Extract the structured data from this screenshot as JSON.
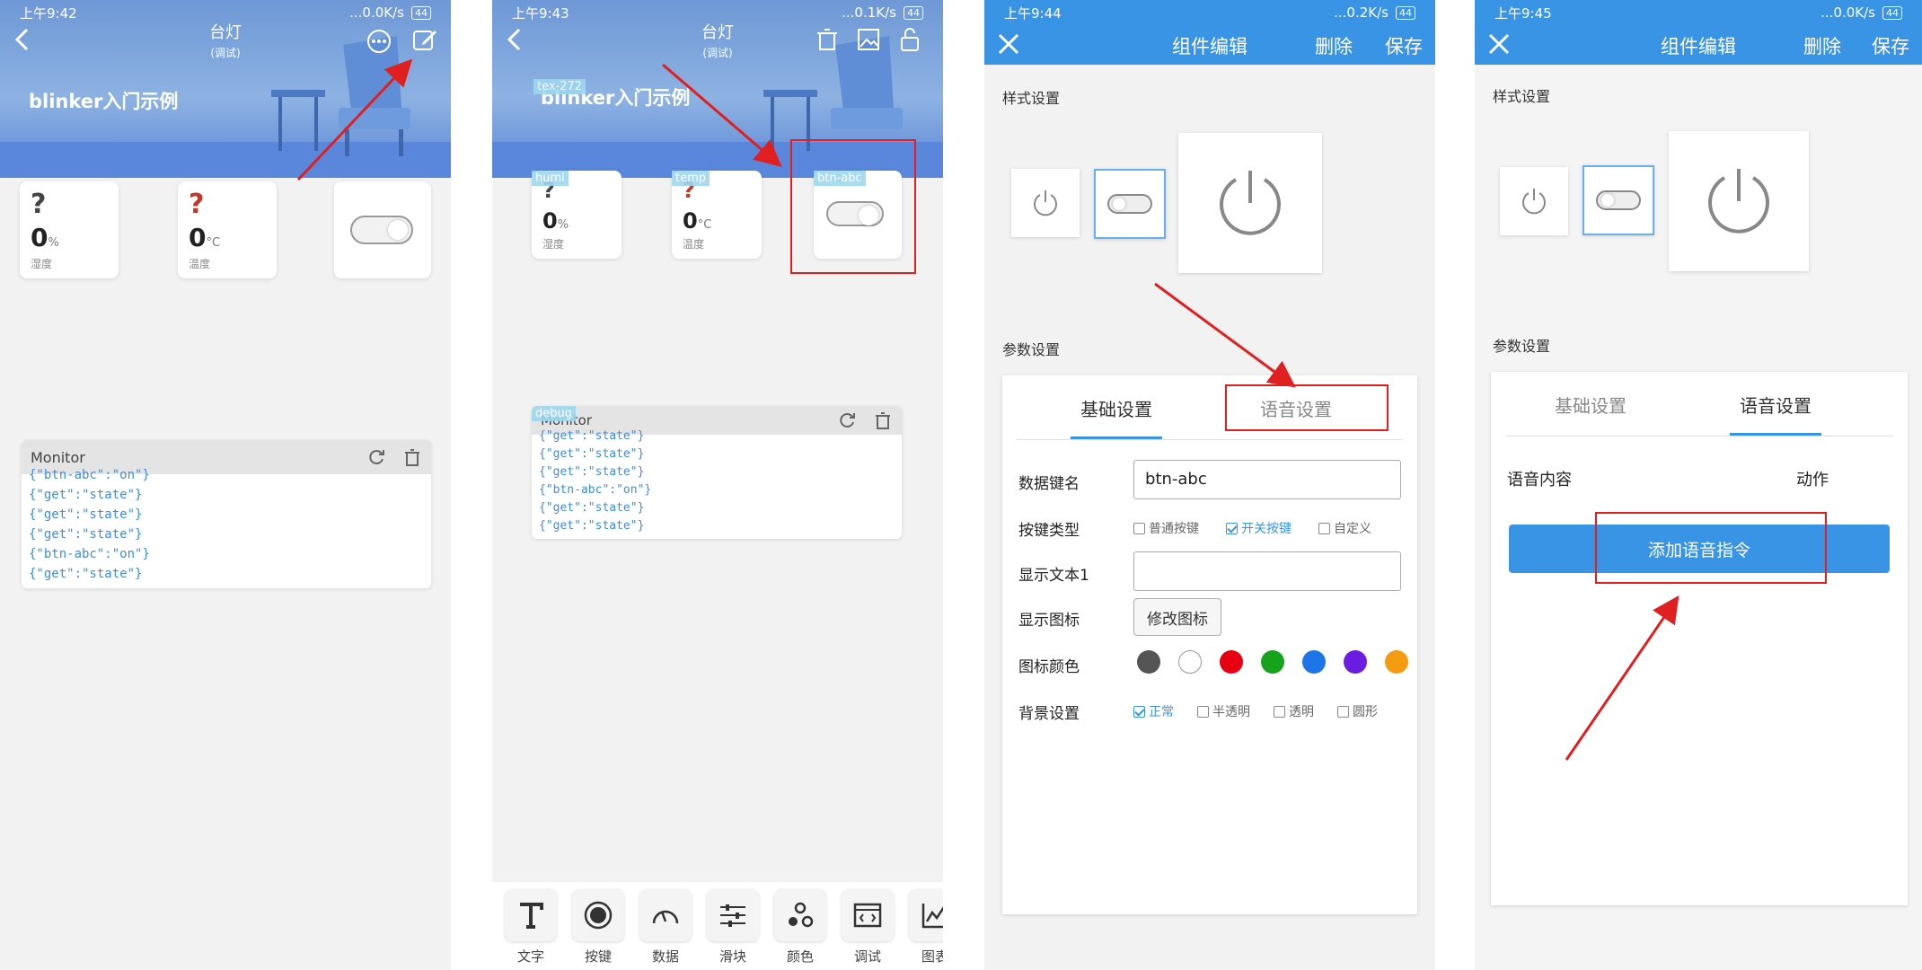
{
  "panel1": {
    "status": {
      "time": "上午9:42",
      "net": "...0.0K/s",
      "battery": "44"
    },
    "title": "台灯",
    "subtitle": "(调试)",
    "device_name": "blinker入门示例",
    "cards": [
      {
        "icon": "?",
        "value": "0",
        "unit": "%",
        "label": "湿度"
      },
      {
        "icon": "?",
        "value": "0",
        "unit": "°C",
        "label": "温度"
      }
    ],
    "monitor": {
      "title": "Monitor",
      "lines": [
        "{\"btn-abc\":\"on\"}",
        "{\"get\":\"state\"}",
        "{\"get\":\"state\"}",
        "{\"get\":\"state\"}",
        "{\"btn-abc\":\"on\"}",
        "{\"get\":\"state\"}"
      ]
    }
  },
  "panel2": {
    "status": {
      "time": "上午9:43",
      "net": "...0.1K/s",
      "battery": "44"
    },
    "title": "台灯",
    "subtitle": "(调试)",
    "device_name": "blinker入门示例",
    "tex_tag": "tex-272",
    "cards": [
      {
        "tag": "humi",
        "icon": "?",
        "value": "0",
        "unit": "%",
        "label": "湿度"
      },
      {
        "tag": "temp",
        "icon": "?",
        "value": "0",
        "unit": "°C",
        "label": "温度"
      }
    ],
    "btn_tag": "btn-abc",
    "monitor": {
      "tag": "debug",
      "title": "Monitor",
      "lines": [
        "{\"get\":\"state\"}",
        "{\"get\":\"state\"}",
        "{\"get\":\"state\"}",
        "{\"btn-abc\":\"on\"}",
        "{\"get\":\"state\"}",
        "{\"get\":\"state\"}"
      ]
    },
    "toolbar": [
      {
        "icon": "text-icon",
        "label": "文字"
      },
      {
        "icon": "button-icon",
        "label": "按键"
      },
      {
        "icon": "gauge-icon",
        "label": "数据"
      },
      {
        "icon": "slider-icon",
        "label": "滑块"
      },
      {
        "icon": "color-icon",
        "label": "颜色"
      },
      {
        "icon": "debug-icon",
        "label": "调试"
      },
      {
        "icon": "chart-icon",
        "label": "图表"
      }
    ]
  },
  "panel3": {
    "status": {
      "time": "上午9:44",
      "net": "...0.2K/s",
      "battery": "44"
    },
    "title": "组件编辑",
    "delete": "删除",
    "save": "保存",
    "style_section": "样式设置",
    "param_section": "参数设置",
    "tabs": [
      "基础设置",
      "语音设置"
    ],
    "fields": {
      "key_label": "数据键名",
      "key_value": "btn-abc",
      "type_label": "按键类型",
      "types": [
        "普通按键",
        "开关按键",
        "自定义"
      ],
      "text_label": "显示文本1",
      "text_value": "",
      "icon_label": "显示图标",
      "icon_button": "修改图标",
      "color_label": "图标颜色",
      "colors": [
        "#555555",
        "#ffffff",
        "#e60012",
        "#16a21c",
        "#1e75e8",
        "#6a1ce0",
        "#f39c12"
      ],
      "bg_label": "背景设置",
      "bgs": [
        "正常",
        "半透明",
        "透明",
        "圆形"
      ]
    }
  },
  "panel4": {
    "status": {
      "time": "上午9:45",
      "net": "...0.0K/s",
      "battery": "44"
    },
    "title": "组件编辑",
    "delete": "删除",
    "save": "保存",
    "style_section": "样式设置",
    "param_section": "参数设置",
    "tabs": [
      "基础设置",
      "语音设置"
    ],
    "voice_content": "语音内容",
    "voice_action": "动作",
    "add_voice": "添加语音指令"
  },
  "colors": {
    "accent": "#3a94e6",
    "annotation": "#e02020",
    "monitor_text": "#3d8ce0"
  }
}
